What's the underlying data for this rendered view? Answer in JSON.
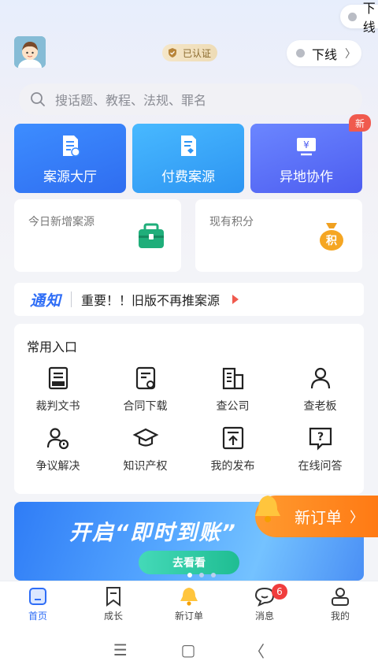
{
  "top_pill": {
    "label": "下线"
  },
  "header": {
    "verified_label": "已认证",
    "status_label": "下线"
  },
  "search": {
    "placeholder": "搜话题、教程、法规、罪名"
  },
  "main_buttons": [
    {
      "label": "案源大厅",
      "icon": "document-icon"
    },
    {
      "label": "付费案源",
      "icon": "paid-document-icon"
    },
    {
      "label": "异地协作",
      "icon": "yen-screen-icon"
    }
  ],
  "new_badge": "新",
  "stats": [
    {
      "label": "今日新增案源",
      "icon": "briefcase-icon"
    },
    {
      "label": "现有积分",
      "icon": "points-bag-icon",
      "icon_text": "积"
    }
  ],
  "notice": {
    "logo": "通知",
    "text": "重要！！旧版不再推案源"
  },
  "quick_entry": {
    "title": "常用入口",
    "items": [
      {
        "label": "裁判文书",
        "icon": "judgment-doc-icon"
      },
      {
        "label": "合同下载",
        "icon": "contract-icon"
      },
      {
        "label": "查公司",
        "icon": "building-icon"
      },
      {
        "label": "查老板",
        "icon": "person-icon"
      },
      {
        "label": "争议解决",
        "icon": "dispute-icon"
      },
      {
        "label": "知识产权",
        "icon": "graduation-cap-icon"
      },
      {
        "label": "我的发布",
        "icon": "publish-icon"
      },
      {
        "label": "在线问答",
        "icon": "question-icon"
      }
    ]
  },
  "banner": {
    "text": "开启“即时到账”",
    "button": "去看看"
  },
  "new_order_float": {
    "label": "新订单"
  },
  "tabbar": {
    "items": [
      {
        "label": "首页",
        "icon": "home-icon"
      },
      {
        "label": "成长",
        "icon": "bookmark-icon"
      },
      {
        "label": "新订单",
        "icon": "bell-icon"
      },
      {
        "label": "消息",
        "icon": "chat-icon",
        "badge": "6"
      },
      {
        "label": "我的",
        "icon": "profile-icon"
      }
    ]
  },
  "system_nav": {
    "menu": "☰",
    "home": "▢",
    "back": "〈"
  },
  "colors": {
    "primary": "#2e6df6",
    "accent_orange": "#ff8a1f",
    "badge_red": "#f03d3d"
  }
}
